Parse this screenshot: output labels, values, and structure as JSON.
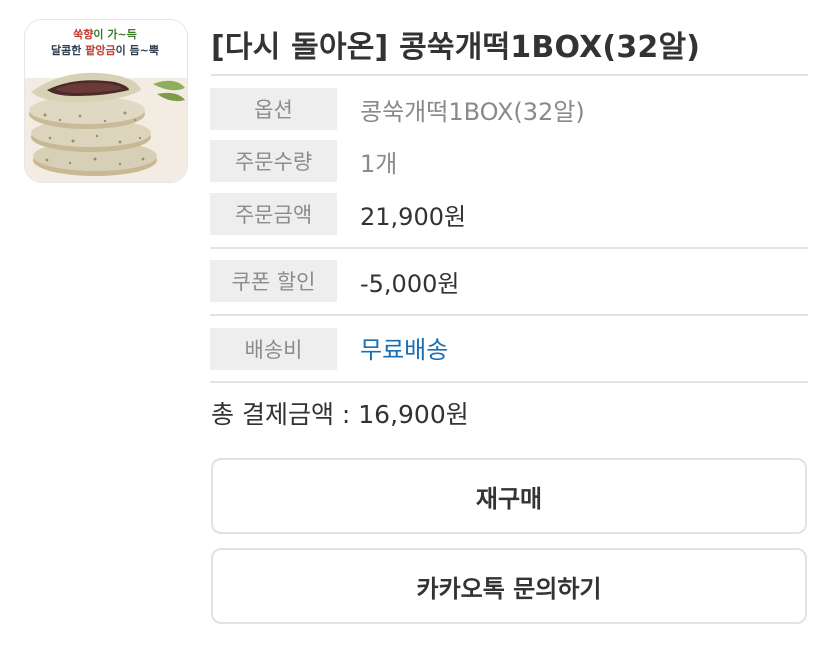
{
  "product": {
    "title": "[다시 돌아온] 콩쑥개떡1BOX(32알)",
    "image_caption_line1": "쑥향이 가~득",
    "image_caption_line2": "달콤한 팥앙금이 듬~뿍"
  },
  "order_info": [
    {
      "label": "옵션",
      "value": "콩쑥개떡1BOX(32알)"
    },
    {
      "label": "주문수량",
      "value": "1개"
    },
    {
      "label": "주문금액",
      "value": "21,900원"
    },
    {
      "label": "쿠폰 할인",
      "value": "-5,000원"
    },
    {
      "label": "배송비",
      "value": "무료배송"
    }
  ],
  "total": {
    "text": "총 결제금액 : 16,900원"
  },
  "buttons": {
    "reorder": "재구매",
    "kakao_inquiry": "카카오톡 문의하기"
  },
  "colors": {
    "label_bg": "#eeeeee",
    "link_blue": "#1a6fb3",
    "rule": "#e3e3e3"
  }
}
